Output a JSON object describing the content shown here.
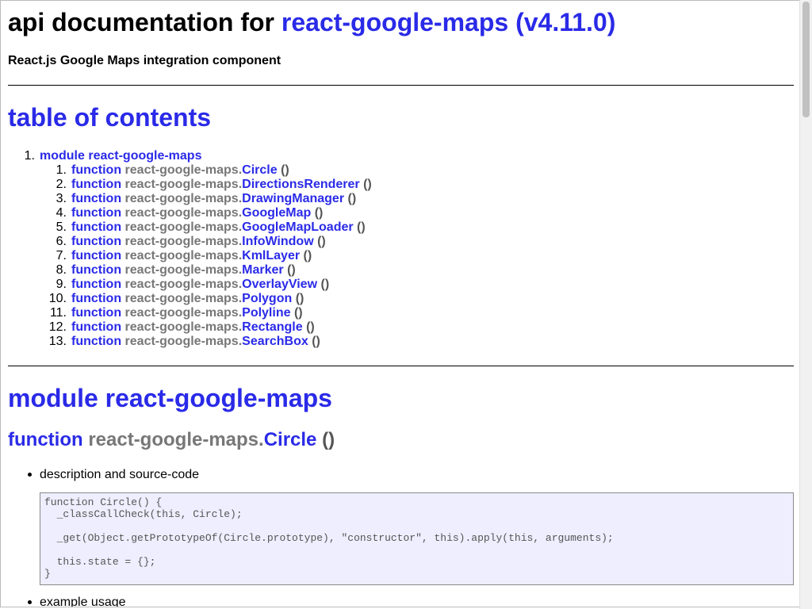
{
  "header": {
    "title_prefix": "api documentation for",
    "title_link": "react-google-maps (v4.11.0)",
    "subtitle": "React.js Google Maps integration component"
  },
  "toc": {
    "heading": "table of contents",
    "module": {
      "num": "1.",
      "label": "module react-google-maps"
    },
    "items": [
      {
        "num": "1.",
        "kw": "function",
        "prefix": "react-google-maps.",
        "name": "Circle",
        "paren": "()"
      },
      {
        "num": "2.",
        "kw": "function",
        "prefix": "react-google-maps.",
        "name": "DirectionsRenderer",
        "paren": "()"
      },
      {
        "num": "3.",
        "kw": "function",
        "prefix": "react-google-maps.",
        "name": "DrawingManager",
        "paren": "()"
      },
      {
        "num": "4.",
        "kw": "function",
        "prefix": "react-google-maps.",
        "name": "GoogleMap",
        "paren": "()"
      },
      {
        "num": "5.",
        "kw": "function",
        "prefix": "react-google-maps.",
        "name": "GoogleMapLoader",
        "paren": "()"
      },
      {
        "num": "6.",
        "kw": "function",
        "prefix": "react-google-maps.",
        "name": "InfoWindow",
        "paren": "()"
      },
      {
        "num": "7.",
        "kw": "function",
        "prefix": "react-google-maps.",
        "name": "KmlLayer",
        "paren": "()"
      },
      {
        "num": "8.",
        "kw": "function",
        "prefix": "react-google-maps.",
        "name": "Marker",
        "paren": "()"
      },
      {
        "num": "9.",
        "kw": "function",
        "prefix": "react-google-maps.",
        "name": "OverlayView",
        "paren": "()"
      },
      {
        "num": "10.",
        "kw": "function",
        "prefix": "react-google-maps.",
        "name": "Polygon",
        "paren": "()"
      },
      {
        "num": "11.",
        "kw": "function",
        "prefix": "react-google-maps.",
        "name": "Polyline",
        "paren": "()"
      },
      {
        "num": "12.",
        "kw": "function",
        "prefix": "react-google-maps.",
        "name": "Rectangle",
        "paren": "()"
      },
      {
        "num": "13.",
        "kw": "function",
        "prefix": "react-google-maps.",
        "name": "SearchBox",
        "paren": "()"
      }
    ]
  },
  "module_section": {
    "heading": "module react-google-maps",
    "function": {
      "kw": "function",
      "prefix": "react-google-maps.",
      "name": "Circle",
      "paren": "()"
    },
    "bullet_description": "description and source-code",
    "code": "function Circle() {\n  _classCallCheck(this, Circle);\n\n  _get(Object.getPrototypeOf(Circle.prototype), \"constructor\", this).apply(this, arguments);\n\n  this.state = {};\n}",
    "bullet_example": "example usage"
  },
  "colors": {
    "link": "#2a2ae8",
    "muted": "#777777",
    "code_bg": "#eeeeff"
  }
}
